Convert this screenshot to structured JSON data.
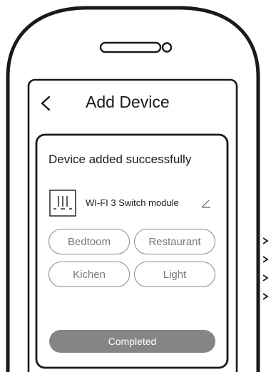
{
  "header": {
    "title": "Add Device",
    "back_icon": "chevron-left-icon"
  },
  "card": {
    "status_text": "Device added successfully",
    "device": {
      "name": "WI-FI 3 Switch module",
      "icon": "switch-module-icon",
      "edit_icon": "pencil-icon"
    },
    "rooms": [
      "Bedtoom",
      "Restaurant",
      "Kichen",
      "Light"
    ],
    "completed_label": "Completed"
  },
  "side_indicators": [
    "chevron-right-icon",
    "chevron-right-icon",
    "chevron-right-icon",
    "chevron-right-icon"
  ]
}
